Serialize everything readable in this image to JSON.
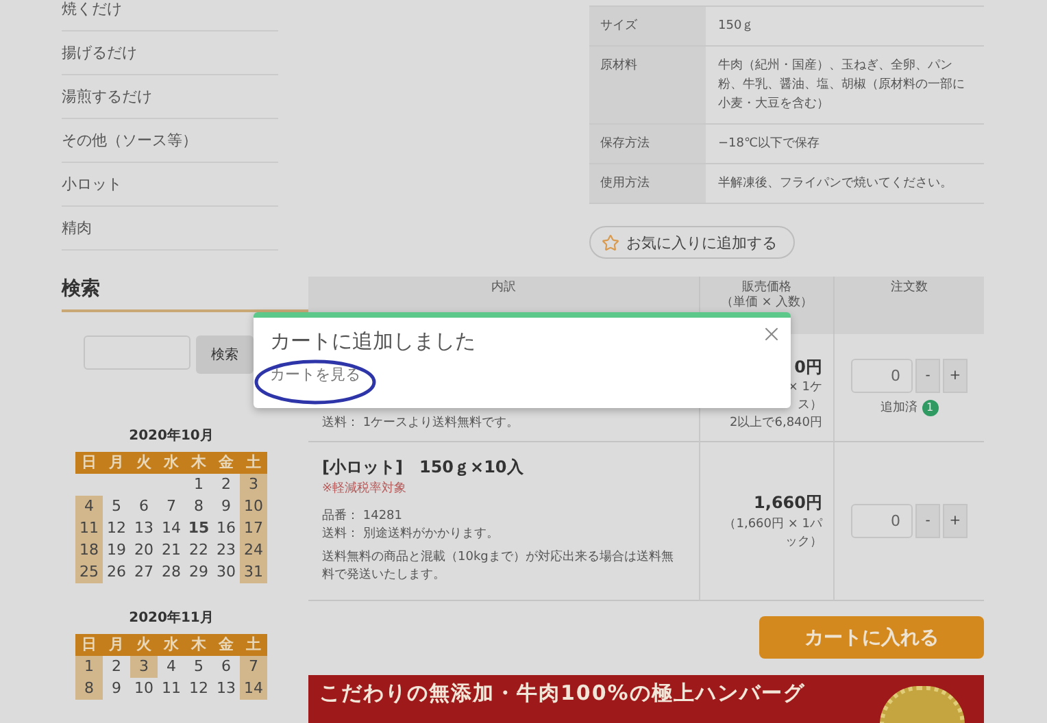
{
  "sidebar": {
    "categories": [
      "焼くだけ",
      "揚げるだけ",
      "湯煎するだけ",
      "その他（ソース等）",
      "小ロット",
      "精肉"
    ],
    "search": {
      "heading": "検索",
      "button": "検索"
    },
    "calendars": [
      {
        "title": "2020年10月",
        "weekdays": [
          "日",
          "月",
          "火",
          "水",
          "木",
          "金",
          "土"
        ],
        "weeks": [
          [
            {
              "day": "1",
              "off": false,
              "today": false
            },
            {
              "day": "2",
              "off": false,
              "today": false
            },
            {
              "day": "3",
              "off": true,
              "today": false
            }
          ],
          [
            {
              "day": "4",
              "off": true,
              "today": false
            },
            {
              "day": "5",
              "off": false,
              "today": false
            },
            {
              "day": "6",
              "off": false,
              "today": false
            },
            {
              "day": "7",
              "off": false,
              "today": false
            },
            {
              "day": "8",
              "off": false,
              "today": false
            },
            {
              "day": "9",
              "off": false,
              "today": false
            },
            {
              "day": "10",
              "off": true,
              "today": false
            }
          ],
          [
            {
              "day": "11",
              "off": true,
              "today": false
            },
            {
              "day": "12",
              "off": false,
              "today": false
            },
            {
              "day": "13",
              "off": false,
              "today": false
            },
            {
              "day": "14",
              "off": false,
              "today": false
            },
            {
              "day": "15",
              "off": false,
              "today": true
            },
            {
              "day": "16",
              "off": false,
              "today": false
            },
            {
              "day": "17",
              "off": true,
              "today": false
            }
          ],
          [
            {
              "day": "18",
              "off": true,
              "today": false
            },
            {
              "day": "19",
              "off": false,
              "today": false
            },
            {
              "day": "20",
              "off": false,
              "today": false
            },
            {
              "day": "21",
              "off": false,
              "today": false
            },
            {
              "day": "22",
              "off": false,
              "today": false
            },
            {
              "day": "23",
              "off": false,
              "today": false
            },
            {
              "day": "24",
              "off": true,
              "today": false
            }
          ],
          [
            {
              "day": "25",
              "off": true,
              "today": false
            },
            {
              "day": "26",
              "off": false,
              "today": false
            },
            {
              "day": "27",
              "off": false,
              "today": false
            },
            {
              "day": "28",
              "off": false,
              "today": false
            },
            {
              "day": "29",
              "off": false,
              "today": false
            },
            {
              "day": "30",
              "off": false,
              "today": false
            },
            {
              "day": "31",
              "off": true,
              "today": false
            }
          ]
        ]
      },
      {
        "title": "2020年11月",
        "weekdays": [
          "日",
          "月",
          "火",
          "水",
          "木",
          "金",
          "土"
        ],
        "weeks": [
          [
            {
              "day": "1",
              "off": true,
              "today": false
            },
            {
              "day": "2",
              "off": false,
              "today": false
            },
            {
              "day": "3",
              "off": true,
              "today": false
            },
            {
              "day": "4",
              "off": false,
              "today": false
            },
            {
              "day": "5",
              "off": false,
              "today": false
            },
            {
              "day": "6",
              "off": false,
              "today": false
            },
            {
              "day": "7",
              "off": true,
              "today": false
            }
          ],
          [
            {
              "day": "8",
              "off": true,
              "today": false
            },
            {
              "day": "9",
              "off": false,
              "today": false
            },
            {
              "day": "10",
              "off": false,
              "today": false
            },
            {
              "day": "11",
              "off": false,
              "today": false
            },
            {
              "day": "12",
              "off": false,
              "today": false
            },
            {
              "day": "13",
              "off": false,
              "today": false
            },
            {
              "day": "14",
              "off": true,
              "today": false
            }
          ]
        ]
      }
    ]
  },
  "spec_table": [
    {
      "label": "サイズ",
      "value": "150ｇ"
    },
    {
      "label": "原材料",
      "value": "牛肉（紀州・国産）、玉ねぎ、全卵、パン粉、牛乳、醤油、塩、胡椒（原材料の一部に小麦・大豆を含む）"
    },
    {
      "label": "保存方法",
      "value": "−18℃以下で保存"
    },
    {
      "label": "使用方法",
      "value": "半解凍後、フライパンで焼いてください。"
    }
  ],
  "favorite_button": "お気に入りに追加する",
  "cart_table": {
    "columns": [
      {
        "label": "内訳"
      },
      {
        "label": "販売価格",
        "sublabel": "（単価 × 入数）"
      },
      {
        "label": "注文数"
      }
    ],
    "rows": [
      {
        "shipping": "送料： 1ケースより送料無料です。",
        "price": "0円",
        "unit_lines": [
          "× 1ケ",
          "ス）"
        ],
        "price_note": "2以上で6,840円",
        "qty": "0",
        "minus": "-",
        "plus": "+",
        "added": {
          "label": "追加済",
          "count": "1"
        }
      },
      {
        "name": "[小ロット]　150ｇ×10入",
        "tax_note": "※軽減税率対象",
        "item_no": "品番： 14281",
        "shipping": "送料： 別途送料がかかります。",
        "remark": "送料無料の商品と混載（10kgまで）が対応出来る場合は送料無料で発送いたします。",
        "price": "1,660円",
        "unit_lines": [
          "（1,660円 × 1パ",
          "ック）"
        ],
        "qty": "0",
        "minus": "-",
        "plus": "+"
      }
    ]
  },
  "cart_button": "カートに入れる",
  "banner": "こだわりの無添加・牛肉100%の極上ハンバーグ",
  "modal": {
    "title": "カートに追加しました",
    "link": "カートを見る"
  }
}
